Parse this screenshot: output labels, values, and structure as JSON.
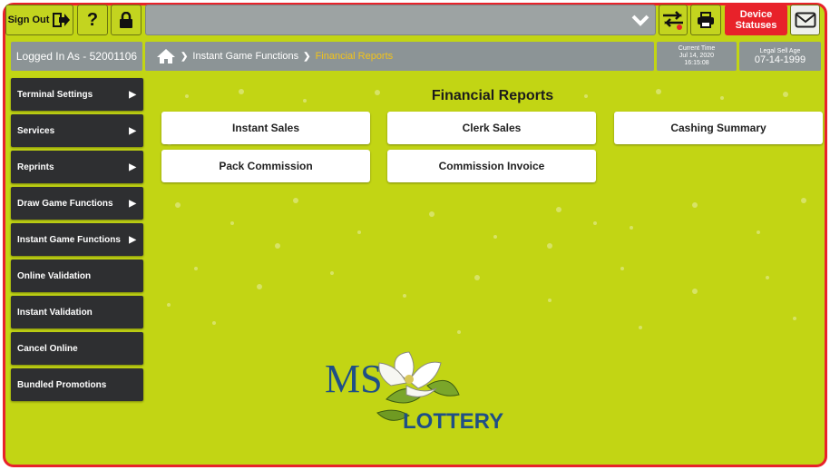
{
  "topbar": {
    "signout_label": "Sign Out",
    "help_label": "?",
    "device_statuses_label": [
      "Device",
      "Statuses"
    ]
  },
  "status": {
    "logged_in": "Logged In As - 52001106",
    "current_time_label": "Current Time",
    "current_date": "Jul 14, 2020",
    "current_clock": "16:15:08",
    "legal_sell_age_label": "Legal Sell Age",
    "legal_sell_age": "07-14-1999"
  },
  "breadcrumb": {
    "items": [
      "Instant Game Functions",
      "Financial Reports"
    ]
  },
  "sidebar": {
    "items": [
      {
        "label": "Terminal Settings",
        "arrow": "▶"
      },
      {
        "label": "Services",
        "arrow": "▶"
      },
      {
        "label": "Reprints",
        "arrow": "▶"
      },
      {
        "label": "Draw Game Functions",
        "arrow": "▶"
      },
      {
        "label": "Instant Game Functions",
        "arrow": "▶"
      },
      {
        "label": "Online Validation",
        "arrow": ""
      },
      {
        "label": "Instant Validation",
        "arrow": ""
      },
      {
        "label": "Cancel Online",
        "arrow": ""
      },
      {
        "label": "Bundled Promotions",
        "arrow": ""
      }
    ]
  },
  "main": {
    "title": "Financial Reports",
    "buttons": [
      "Instant Sales",
      "Clerk Sales",
      "Cashing Summary",
      "Pack Commission",
      "Commission Invoice"
    ]
  },
  "logo": {
    "ms": "MS",
    "lottery": "LOTTERY"
  },
  "colors": {
    "background": "#c2d514",
    "frame": "#e8222a",
    "sidebar": "#2e2f31",
    "crumb_current": "#f2c319",
    "logo_blue": "#1f4f86"
  }
}
